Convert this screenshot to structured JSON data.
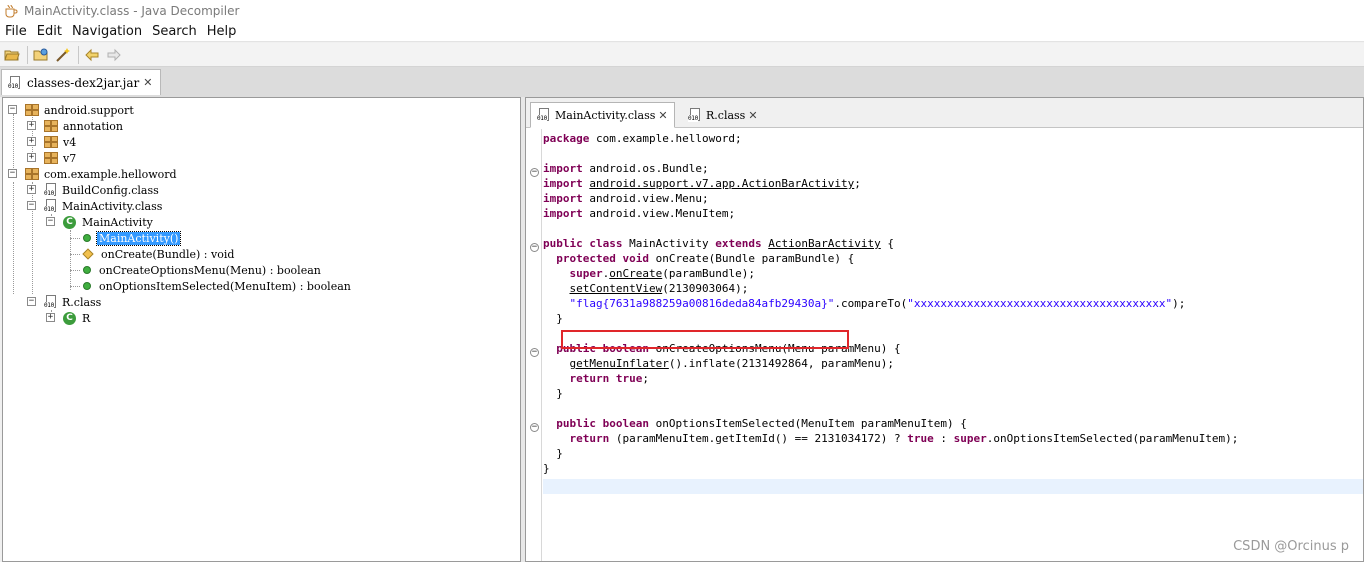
{
  "window": {
    "title": "MainActivity.class - Java Decompiler"
  },
  "menu": [
    "File",
    "Edit",
    "Navigation",
    "Search",
    "Help"
  ],
  "toolbar": {
    "icons": [
      "open-file-icon",
      "open-folder-icon",
      "wand-icon",
      "back-arrow-icon",
      "forward-arrow-icon"
    ]
  },
  "outer_tab": {
    "label": "classes-dex2jar.jar"
  },
  "tree": {
    "pkg_android_support": "android.support",
    "pkg_annotation": "annotation",
    "pkg_v4": "v4",
    "pkg_v7": "v7",
    "pkg_helloword": "com.example.helloword",
    "file_buildconfig": "BuildConfig.class",
    "file_mainactivity": "MainActivity.class",
    "class_mainactivity": "MainActivity",
    "m_ctor": "MainActivity()",
    "m_oncreate": "onCreate(Bundle) : void",
    "m_oncreateoptions": "onCreateOptionsMenu(Menu) : boolean",
    "m_onoptions": "onOptionsItemSelected(MenuItem) : boolean",
    "file_r": "R.class",
    "class_r": "R",
    "class_icon_letter": "C"
  },
  "editor_tabs": {
    "tab1": "MainActivity.class",
    "tab2": "R.class"
  },
  "code": {
    "l1_kw": "package",
    "l1_rest": " com.example.helloword;",
    "imp": "import",
    "l3_rest": " android.os.Bundle;",
    "l4_ul": "android.support.v7.app.ActionBarActivity",
    "l5_rest": " android.view.Menu;",
    "l6_rest": " android.view.MenuItem;",
    "public": "public",
    "class": "class",
    "extends": "extends",
    "class_name": " MainActivity ",
    "superclass": "ActionBarActivity",
    "open_brace": " {",
    "protected": "protected",
    "void": "void",
    "oncreate_sig": " onCreate(Bundle paramBundle) {",
    "super": "super",
    "oncreate_call": "onCreate",
    "oncreate_args": "(paramBundle);",
    "setcontentview": "setContentView",
    "setcontentview_args": "(2130903064);",
    "flag_string": "\"flag{7631a988259a00816deda84afb29430a}\"",
    "compare_call": ".compareTo(",
    "xstring": "\"xxxxxxxxxxxxxxxxxxxxxxxxxxxxxxxxxxxxxx\"",
    "compare_end": ");",
    "close_brace": "}",
    "boolean": "boolean",
    "oncreateoptions_sig": " onCreateOptionsMenu(Menu paramMenu) {",
    "getmenuinflater": "getMenuInflater",
    "inflate_rest": "().inflate(2131492864, paramMenu);",
    "return": "return",
    "true": "true",
    "onoptions_sig": " onOptionsItemSelected(MenuItem paramMenuItem) {",
    "return_expr": " (paramMenuItem.getItemId() == 2131034172) ? ",
    "colon": " : ",
    "onoptions_call": ".onOptionsItemSelected(paramMenuItem);"
  },
  "watermark": "CSDN @Orcinus p",
  "colors": {
    "keyword": "#7f0055",
    "string": "#2a00ff",
    "highlight_border": "#e0262a",
    "selection": "#3399ff"
  }
}
